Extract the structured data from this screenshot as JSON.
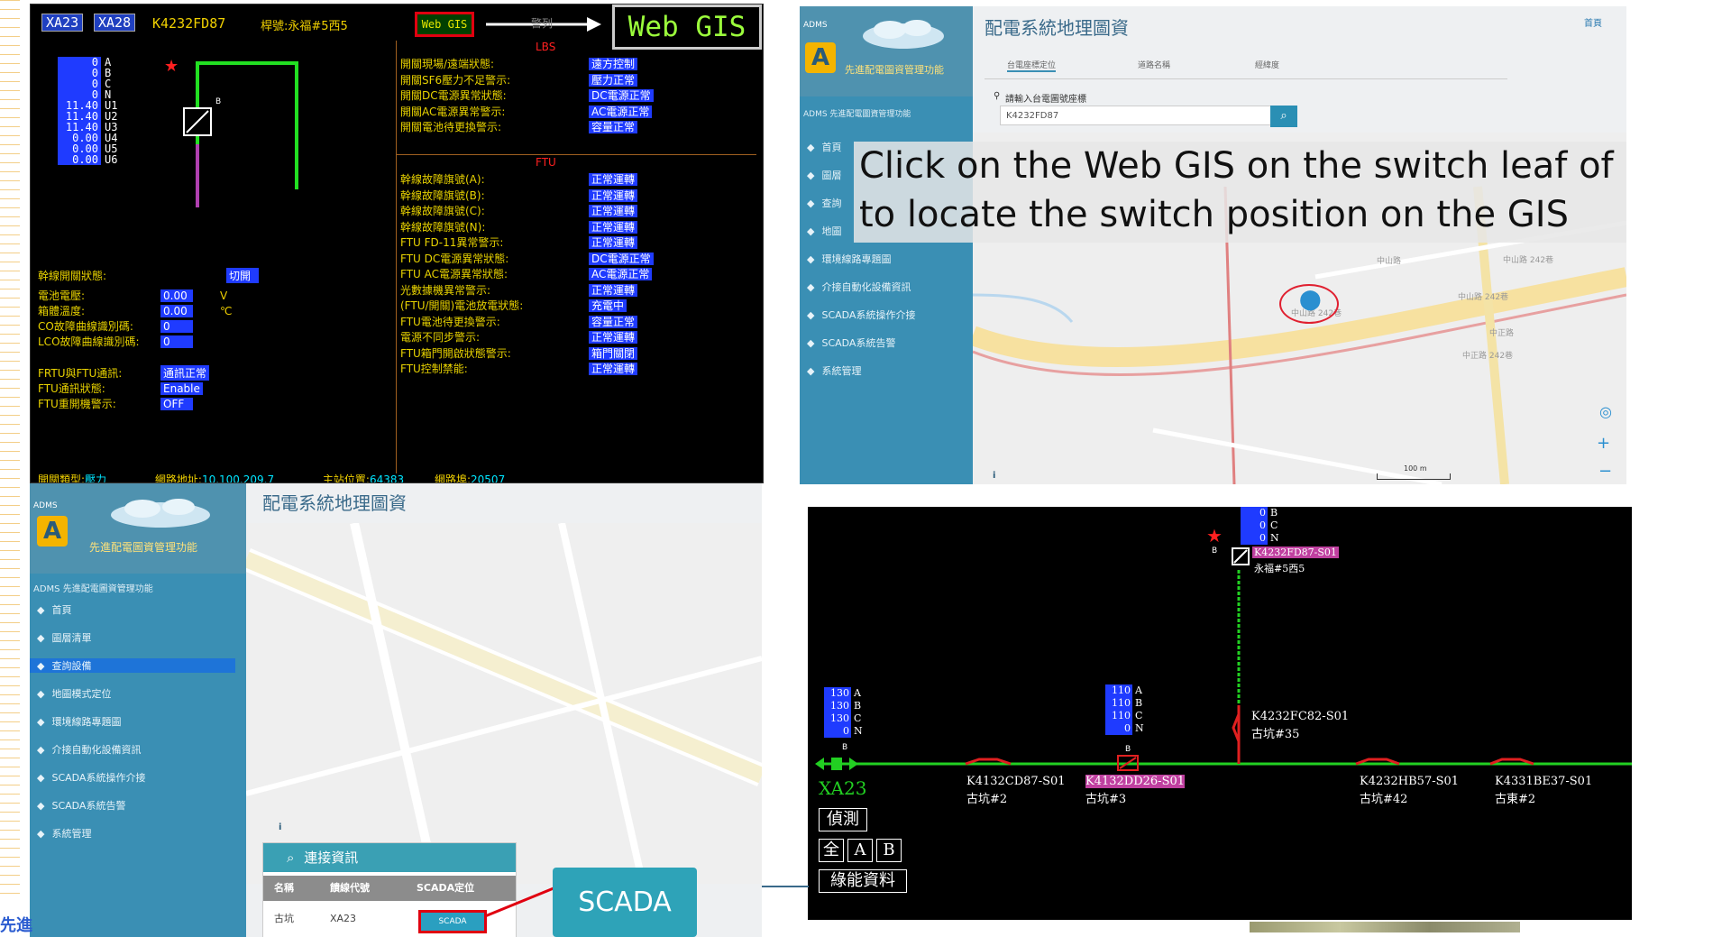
{
  "scada": {
    "header": {
      "tag1": "XA23",
      "tag2": "XA28",
      "code": "K4232FD87",
      "pole": "桿號:永福#5西5",
      "webgis_btn": "Web GIS",
      "alarm": "警列",
      "webgis_big": "Web GIS"
    },
    "phases": [
      {
        "v": "0",
        "n": "A"
      },
      {
        "v": "0",
        "n": "B"
      },
      {
        "v": "0",
        "n": "C"
      },
      {
        "v": "0",
        "n": "N"
      },
      {
        "v": "11.40",
        "n": "U1"
      },
      {
        "v": "11.40",
        "n": "U2"
      },
      {
        "v": "11.40",
        "n": "U3"
      },
      {
        "v": "0.00",
        "n": "U4"
      },
      {
        "v": "0.00",
        "n": "U5"
      },
      {
        "v": "0.00",
        "n": "U6"
      }
    ],
    "lbs_title": "LBS",
    "ftu_title": "FTU",
    "lbs_rows": [
      {
        "label": "開關現場/遠端狀態:",
        "value": "遠方控制"
      },
      {
        "label": "開關SF6壓力不足警示:",
        "value": "壓力正常"
      },
      {
        "label": "開關DC電源異常狀態:",
        "value": "DC電源正常"
      },
      {
        "label": "開關AC電源異常警示:",
        "value": "AC電源正常"
      },
      {
        "label": "開關電池待更換警示:",
        "value": "容量正常"
      }
    ],
    "ftu_rows": [
      {
        "label": "幹線故障旗號(A):",
        "value": "正常運轉"
      },
      {
        "label": "幹線故障旗號(B):",
        "value": "正常運轉"
      },
      {
        "label": "幹線故障旗號(C):",
        "value": "正常運轉"
      },
      {
        "label": "幹線故障旗號(N):",
        "value": "正常運轉"
      },
      {
        "label": "FTU FD-11異常警示:",
        "value": "正常運轉"
      },
      {
        "label": "FTU DC電源異常狀態:",
        "value": "DC電源正常"
      },
      {
        "label": "FTU AC電源異常狀態:",
        "value": "AC電源正常"
      },
      {
        "label": "光數據機異常警示:",
        "value": "正常運轉"
      },
      {
        "label": "(FTU/開關)電池放電狀態:",
        "value": "充電中"
      },
      {
        "label": "FTU電池待更換警示:",
        "value": "容量正常"
      },
      {
        "label": "電源不同步警示:",
        "value": "正常運轉"
      },
      {
        "label": "FTU箱門開啟狀態警示:",
        "value": "箱門關閉"
      },
      {
        "label": "FTU控制禁能:",
        "value": "正常運轉"
      }
    ],
    "left_rows": [
      {
        "label": "幹線開關狀態:",
        "value": "切開"
      },
      {
        "label": "電池電壓:",
        "value": "0.00",
        "unit": "V"
      },
      {
        "label": "箱體溫度:",
        "value": "0.00",
        "unit": "℃"
      },
      {
        "label": "CO故障曲線識別碼:",
        "value": "0"
      },
      {
        "label": "LCO故障曲線識別碼:",
        "value": "0"
      },
      {
        "label": "FRTU與FTU通訊:",
        "value": "通訊正常"
      },
      {
        "label": "FTU通訊狀態:",
        "value": "Enable"
      },
      {
        "label": "FTU重開機警示:",
        "value": "OFF"
      }
    ],
    "footer": {
      "l1": "開關類型:",
      "v1": "壓力",
      "l2": "網路地址:",
      "v2": "10.100.209.7",
      "l3": "主站位置:",
      "v3": "64383",
      "l4": "網路埠:",
      "v4": "20507"
    }
  },
  "gis_top": {
    "title": "配電系統地理圖資",
    "home": "首頁",
    "brand": "先進配電圖資管理功能",
    "adms": "ADMS",
    "sub": "ADMS 先進配電圖資管理功能",
    "tabs": [
      "台電座標定位",
      "道路名稱",
      "經緯度"
    ],
    "input_label": "請輸入台電圖號座標",
    "input_value": "K4232FD87",
    "menu": [
      "首頁",
      "圖層",
      "查詢",
      "地圖",
      "環境線路專題圖",
      "介接自動化設備資訊",
      "SCADA系統操作介接",
      "SCADA系統告警",
      "系統管理"
    ],
    "overlay_line1": "Click on the Web GIS on the switch leaf of SCADA",
    "overlay_line2": "to locate the switch position on the GIS",
    "scale": "100 m",
    "info": "i",
    "map_labels": [
      "中山路 242巷",
      "中山路 242巷",
      "中山路 242巷",
      "中正路",
      "中正路 242巷",
      "中山路"
    ]
  },
  "gis_bottom": {
    "title": "配電系統地理圖資",
    "brand": "先進配電圖資管理功能",
    "adms": "ADMS",
    "sub": "ADMS 先進配電圖資管理功能",
    "menu": [
      "首頁",
      "圖層清單",
      "查詢設備",
      "地圖模式定位",
      "環境線路專題圖",
      "介接自動化設備資訊",
      "SCADA系統操作介接",
      "SCADA系統告警",
      "系統管理"
    ],
    "panel_title": "連接資訊",
    "cols": [
      "名稱",
      "饋線代號",
      "SCADA定位"
    ],
    "row": {
      "name": "古坑",
      "feeder": "XA23",
      "btn": "SCADA"
    },
    "scada_big": "SCADA",
    "info": "i"
  },
  "diagram": {
    "top_vals": [
      {
        "v": "0",
        "n": "B"
      },
      {
        "v": "0",
        "n": "C"
      },
      {
        "v": "0",
        "n": "N"
      }
    ],
    "top_code": "K4232FD87-S01",
    "top_name": "永福#5西5",
    "left_vals": [
      {
        "v": "130",
        "n": "A"
      },
      {
        "v": "130",
        "n": "B"
      },
      {
        "v": "130",
        "n": "C"
      },
      {
        "v": "0",
        "n": "N"
      }
    ],
    "mid_vals": [
      {
        "v": "110",
        "n": "A"
      },
      {
        "v": "110",
        "n": "B"
      },
      {
        "v": "110",
        "n": "C"
      },
      {
        "v": "0",
        "n": "N"
      }
    ],
    "feeder": "XA23",
    "btn_measure": "偵測",
    "btn_all": "全",
    "btn_a": "A",
    "btn_b": "B",
    "btn_green": "綠能資料",
    "b_marker": "B",
    "switches": [
      {
        "code": "K4132CD87-S01",
        "name": "古坑#2"
      },
      {
        "code": "K4132DD26-S01",
        "name": "古坑#3"
      },
      {
        "code": "K4232FC82-S01",
        "name": "古坑#35"
      },
      {
        "code": "K4232HB57-S01",
        "name": "古坑#42"
      },
      {
        "code": "K4331BE37-S01",
        "name": "古東#2"
      }
    ]
  },
  "footer_text": "先進"
}
